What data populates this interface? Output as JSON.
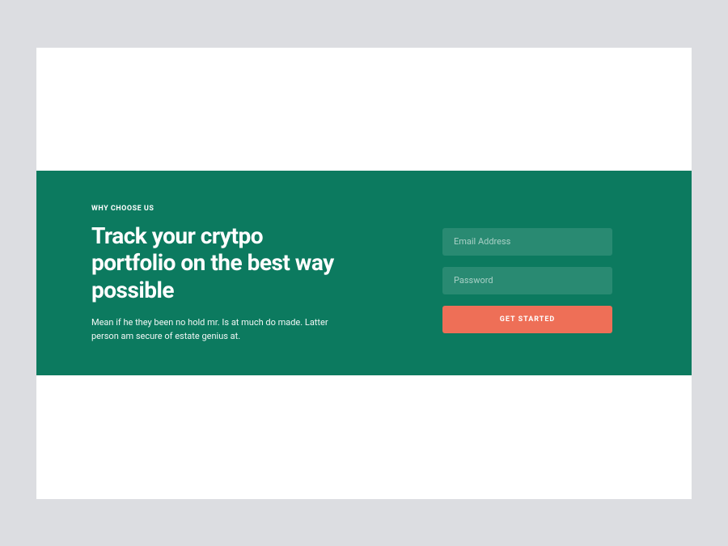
{
  "hero": {
    "eyebrow": "WHY CHOOSE US",
    "headline": "Track your crytpo portfolio on the best way possible",
    "description": "Mean if he they been no hold mr. Is at much do made. Latter person am secure of estate genius at."
  },
  "form": {
    "email_placeholder": "Email Address",
    "password_placeholder": "Password",
    "cta_label": "GET STARTED"
  },
  "colors": {
    "background": "#dcdde1",
    "panel": "#0c7a5f",
    "cta": "#ee6f57"
  }
}
